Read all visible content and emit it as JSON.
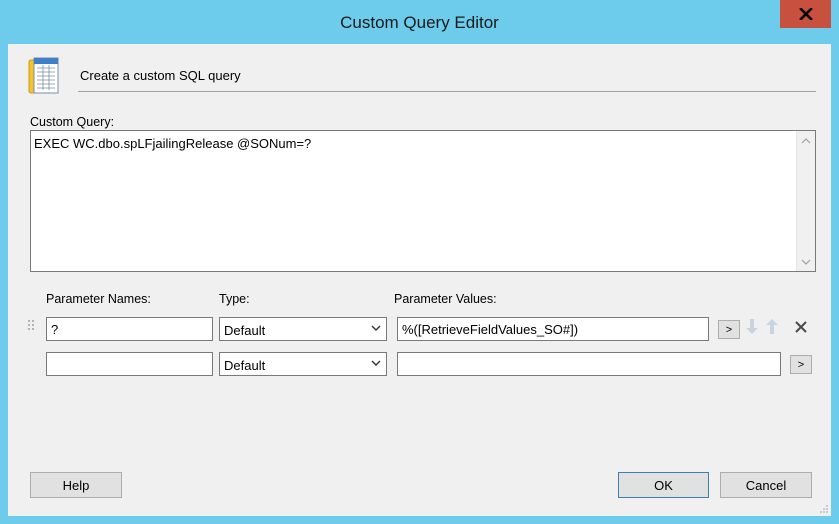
{
  "window": {
    "title": "Custom Query Editor",
    "close_label": "X"
  },
  "header": {
    "icon": "document-table-icon",
    "text": "Create a custom SQL query"
  },
  "query": {
    "label": "Custom Query:",
    "value": "EXEC WC.dbo.spLFjailingRelease @SONum=?"
  },
  "parameters": {
    "headers": {
      "names": "Parameter Names:",
      "type": "Type:",
      "values": "Parameter Values:"
    },
    "rows": [
      {
        "name": "?",
        "type": "Default",
        "value": "%([RetrieveFieldValues_SO#])",
        "browse_label": ">"
      },
      {
        "name": "",
        "type": "Default",
        "value": "",
        "browse_label": ">"
      }
    ]
  },
  "buttons": {
    "help": "Help",
    "ok": "OK",
    "cancel": "Cancel"
  },
  "colors": {
    "title_bar": "#6dccec",
    "close_button": "#c7503f",
    "dialog_body": "#f0f0f0"
  }
}
